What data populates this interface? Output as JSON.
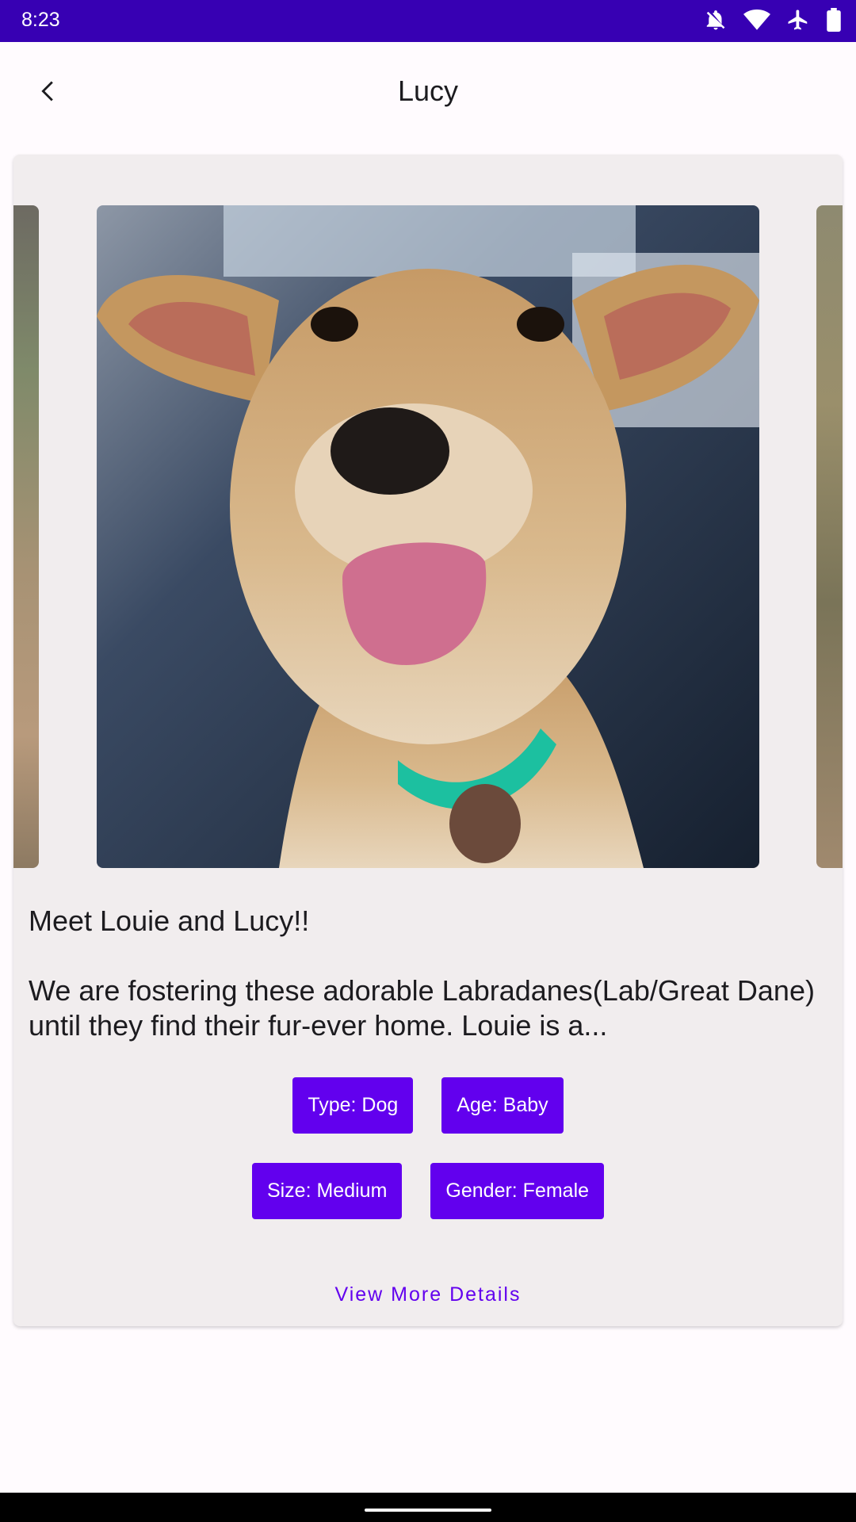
{
  "status_bar": {
    "time": "8:23",
    "icons": [
      "notifications-off-icon",
      "wifi-icon",
      "airplane-icon",
      "battery-icon"
    ],
    "background": "#3700B3"
  },
  "app_bar": {
    "title": "Lucy",
    "back_icon": "arrow-back-icon"
  },
  "card": {
    "photos": [
      "pet-photo-previous",
      "pet-photo-current",
      "pet-photo-next"
    ],
    "description": "Meet Louie and Lucy!!\n\nWe are fostering these adorable Labradanes(Lab/Great Dane) until they find their fur-ever home. Louie is a...",
    "chips": [
      {
        "label": "Type: Dog"
      },
      {
        "label": "Age: Baby"
      },
      {
        "label": "Size: Medium"
      },
      {
        "label": "Gender: Female"
      }
    ],
    "view_more_label": "View More Details"
  },
  "colors": {
    "accent": "#6200EE",
    "card_background": "#F1EDEE",
    "page_background": "#FFFBFE"
  }
}
